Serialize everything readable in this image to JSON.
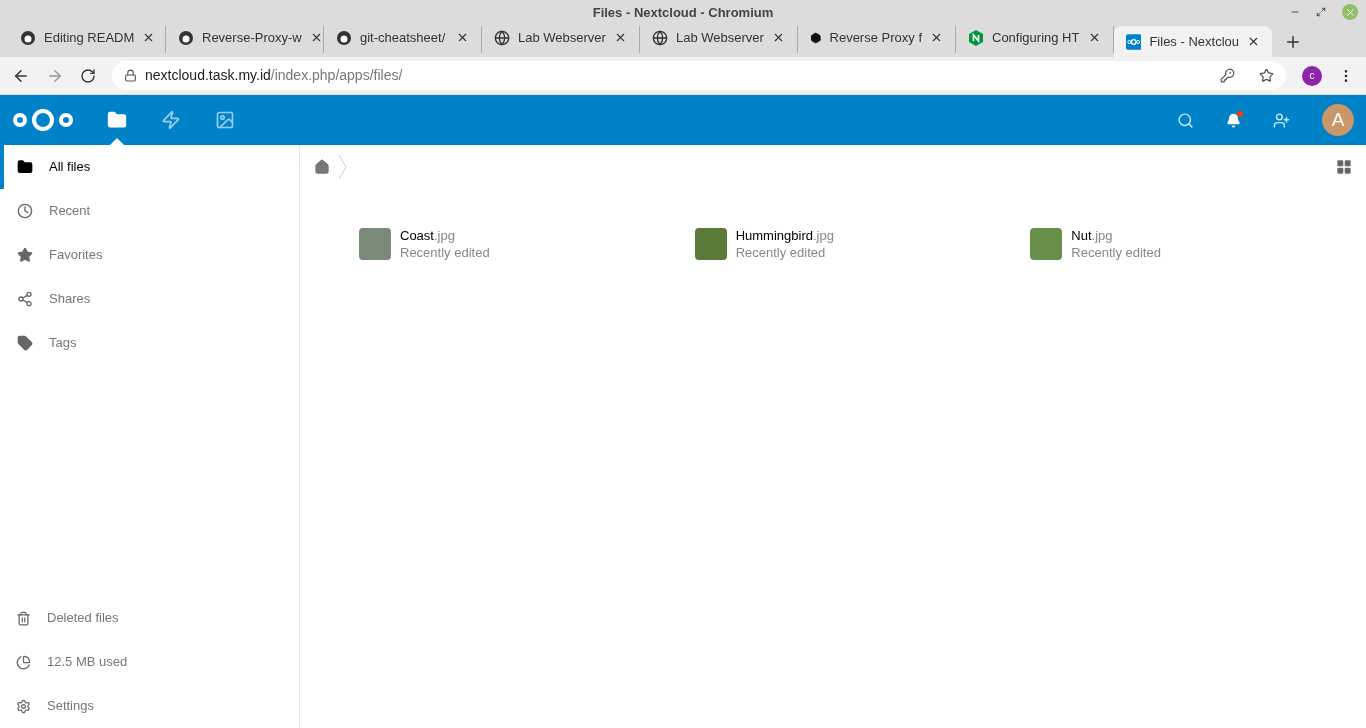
{
  "window": {
    "title": "Files - Nextcloud - Chromium"
  },
  "tabs": [
    {
      "label": "Editing READM",
      "kind": "github",
      "selected": false
    },
    {
      "label": "Reverse-Proxy-w",
      "kind": "github",
      "selected": false
    },
    {
      "label": "git-cheatsheet/",
      "kind": "github",
      "selected": false
    },
    {
      "label": "Lab Webserver",
      "kind": "globe",
      "selected": false
    },
    {
      "label": "Lab Webserver",
      "kind": "globe",
      "selected": false
    },
    {
      "label": "Reverse Proxy f",
      "kind": "hex",
      "selected": false
    },
    {
      "label": "Configuring HT",
      "kind": "nginx",
      "selected": false
    },
    {
      "label": "Files - Nextclou",
      "kind": "nextcloud",
      "selected": true
    }
  ],
  "address": {
    "host": "nextcloud.task.my.id",
    "path": "/index.php/apps/files/"
  },
  "profile": {
    "initial": "c"
  },
  "header": {
    "apps": [
      {
        "kind": "files",
        "selected": true
      },
      {
        "kind": "activity",
        "selected": false
      },
      {
        "kind": "gallery",
        "selected": false
      }
    ],
    "notification_dot": true,
    "avatar": "A"
  },
  "sidebar": {
    "items": [
      {
        "label": "All files",
        "kind": "folder",
        "selected": true
      },
      {
        "label": "Recent",
        "kind": "clock",
        "selected": false
      },
      {
        "label": "Favorites",
        "kind": "star",
        "selected": false
      },
      {
        "label": "Shares",
        "kind": "share",
        "selected": false
      },
      {
        "label": "Tags",
        "kind": "tag",
        "selected": false
      }
    ],
    "bottom": [
      {
        "label": "Deleted files",
        "kind": "trash"
      },
      {
        "label": "12.5 MB used",
        "kind": "pie"
      },
      {
        "label": "Settings",
        "kind": "gear"
      }
    ]
  },
  "files": [
    {
      "name": "Coast",
      "ext": ".jpg",
      "status": "Recently edited",
      "color": "#7a8a78"
    },
    {
      "name": "Hummingbird",
      "ext": ".jpg",
      "status": "Recently edited",
      "color": "#5c7a3a"
    },
    {
      "name": "Nut",
      "ext": ".jpg",
      "status": "Recently edited",
      "color": "#6a8f4a"
    }
  ]
}
